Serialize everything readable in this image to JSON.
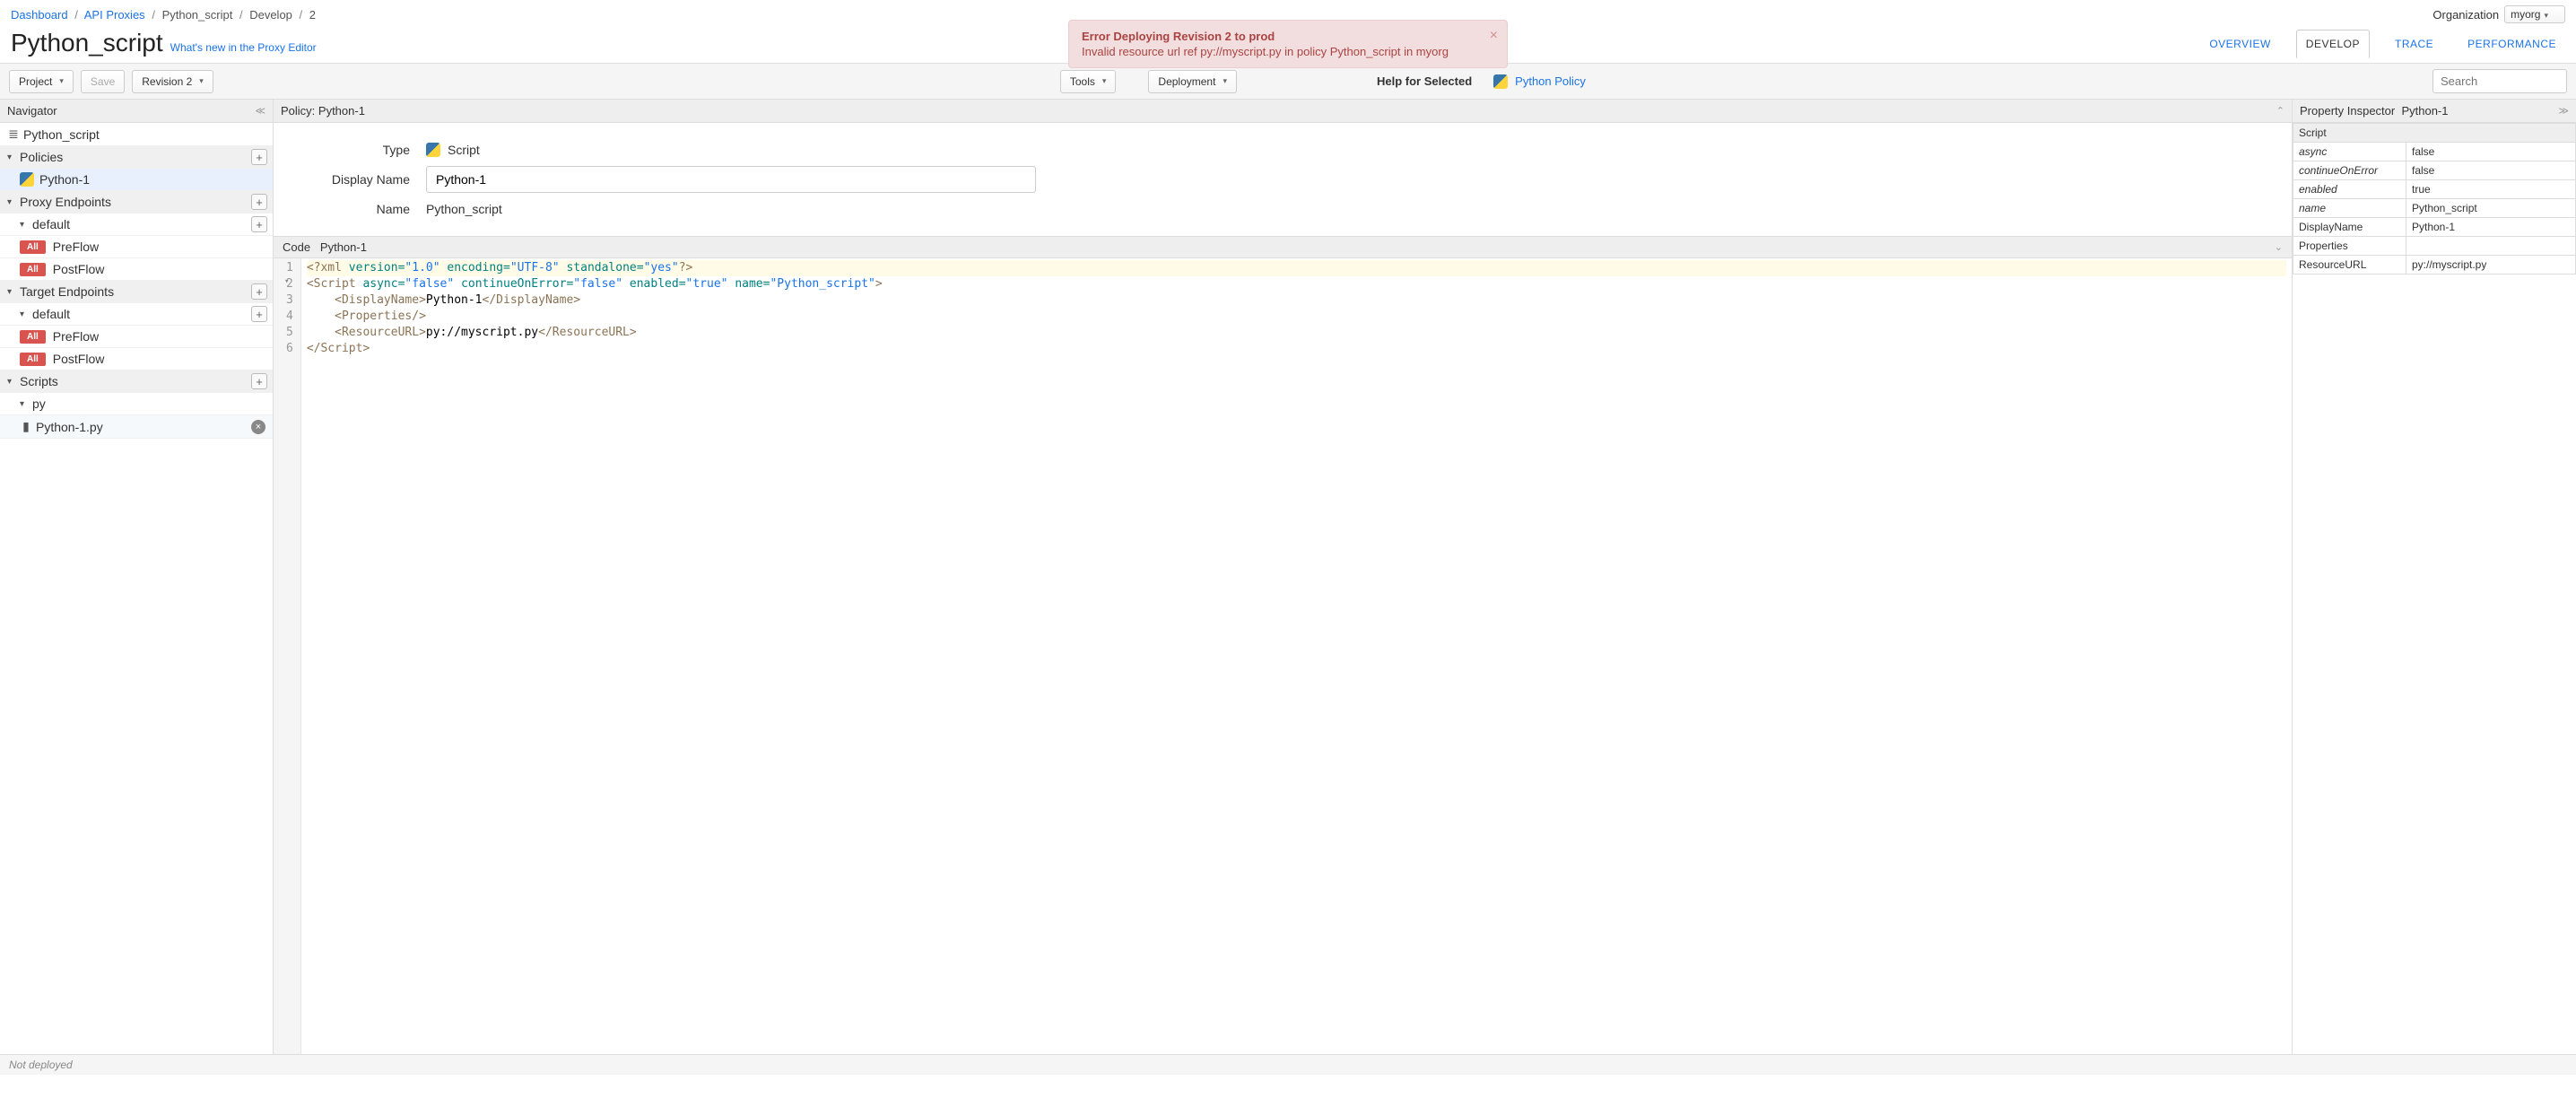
{
  "breadcrumb": {
    "dashboard": "Dashboard",
    "api_proxies": "API Proxies",
    "proxy": "Python_script",
    "section": "Develop",
    "rev": "2"
  },
  "org": {
    "label": "Organization",
    "value": "myorg"
  },
  "title": "Python_script",
  "whats_new": "What's new in the Proxy Editor",
  "alert": {
    "title": "Error Deploying Revision 2 to prod",
    "body": "Invalid resource url ref py://myscript.py in policy Python_script in myorg"
  },
  "tabs": {
    "overview": "OVERVIEW",
    "develop": "DEVELOP",
    "trace": "TRACE",
    "performance": "PERFORMANCE"
  },
  "toolbar": {
    "project": "Project",
    "save": "Save",
    "revision": "Revision 2",
    "tools": "Tools",
    "deployment": "Deployment",
    "help_label": "Help for Selected",
    "help_link": "Python Policy",
    "search_placeholder": "Search"
  },
  "nav": {
    "title": "Navigator",
    "root": "Python_script",
    "policies_label": "Policies",
    "policy_item": "Python-1",
    "proxy_endpoints_label": "Proxy Endpoints",
    "default_label": "default",
    "preflow": "PreFlow",
    "postflow": "PostFlow",
    "target_endpoints_label": "Target Endpoints",
    "scripts_label": "Scripts",
    "py_label": "py",
    "script_file": "Python-1.py",
    "all_badge": "All"
  },
  "policy": {
    "header": "Policy: Python-1",
    "type_label": "Type",
    "type_value": "Script",
    "display_name_label": "Display Name",
    "display_name_value": "Python-1",
    "name_label": "Name",
    "name_value": "Python_script",
    "code_label": "Code",
    "code_name": "Python-1"
  },
  "code": {
    "l1_a": "<?",
    "l1_b": "xml",
    "l1_c": " version=",
    "l1_d": "\"1.0\"",
    "l1_e": " encoding=",
    "l1_f": "\"UTF-8\"",
    "l1_g": " standalone=",
    "l1_h": "\"yes\"",
    "l1_i": "?>",
    "l2_a": "<",
    "l2_b": "Script",
    "l2_c": " async=",
    "l2_d": "\"false\"",
    "l2_e": " continueOnError=",
    "l2_f": "\"false\"",
    "l2_g": " enabled=",
    "l2_h": "\"true\"",
    "l2_i": " name=",
    "l2_j": "\"Python_script\"",
    "l2_k": ">",
    "l3_a": "    <",
    "l3_b": "DisplayName",
    "l3_c": ">",
    "l3_d": "Python-1",
    "l3_e": "</",
    "l3_f": "DisplayName",
    "l3_g": ">",
    "l4_a": "    <",
    "l4_b": "Properties",
    "l4_c": "/>",
    "l5_a": "    <",
    "l5_b": "ResourceURL",
    "l5_c": ">",
    "l5_d": "py://myscript.py",
    "l5_e": "</",
    "l5_f": "ResourceURL",
    "l5_g": ">",
    "l6_a": "</",
    "l6_b": "Script",
    "l6_c": ">"
  },
  "inspector": {
    "title": "Property Inspector",
    "subject": "Python-1",
    "section": "Script",
    "rows": {
      "async_k": "async",
      "async_v": "false",
      "coe_k": "continueOnError",
      "coe_v": "false",
      "enabled_k": "enabled",
      "enabled_v": "true",
      "name_k": "name",
      "name_v": "Python_script",
      "dn_k": "DisplayName",
      "dn_v": "Python-1",
      "props_k": "Properties",
      "props_v": "",
      "res_k": "ResourceURL",
      "res_v": "py://myscript.py"
    }
  },
  "status": "Not deployed"
}
